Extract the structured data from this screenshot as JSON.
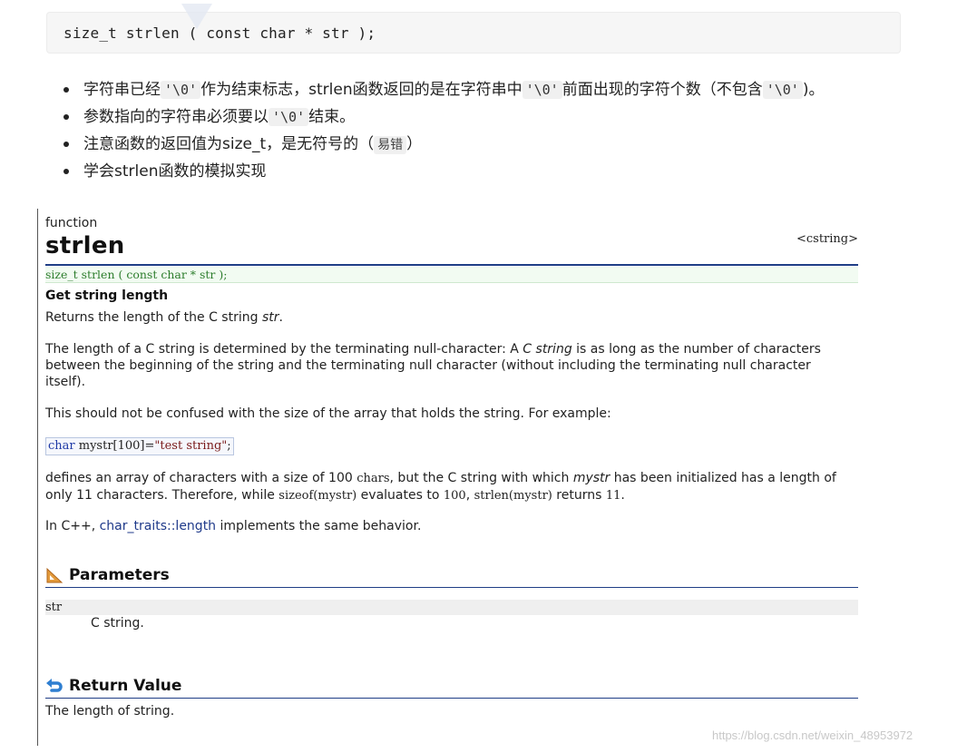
{
  "top": {
    "prototype": "size_t strlen ( const char * str );",
    "bullets": [
      {
        "a": "字符串已经",
        "b": "'\\0'",
        "c": "作为结束标志，strlen函数返回的是在字符串中",
        "d": "'\\0'",
        "e": "前面出现的字符个数（不包含",
        "f": "'\\0'",
        "g": ")。"
      },
      {
        "a": "参数指向的字符串必须要以",
        "b": "'\\0'",
        "c": "结束。"
      },
      {
        "a": "注意函数的返回值为size_t，是无符号的（",
        "b": "易错",
        "c": "）"
      },
      {
        "a": "学会strlen函数的模拟实现"
      }
    ]
  },
  "ref": {
    "kind": "function",
    "name": "strlen",
    "header": "<cstring>",
    "prototype": "size_t strlen ( const char * str );",
    "brief": "Get string length",
    "p1": {
      "text": "Returns the length of the C string ",
      "em": "str",
      "end": "."
    },
    "p2": {
      "a": "The length of a C string is determined by the terminating null-character: A ",
      "em": "C string",
      "b": " is as long as the number of characters between the beginning of the string and the terminating null character (without including the terminating null character itself)."
    },
    "p3": "This should not be confused with the size of the array that holds the string. For example:",
    "example": {
      "kw": "char",
      "mid": " mystr[100]=",
      "str": "\"test string\"",
      "end": ";"
    },
    "p4": {
      "a": "defines an array of characters with a size of 100 ",
      "m1": "chars",
      "b": ", but the C string with which ",
      "em": "mystr",
      "c": " has been initialized has a length of only 11 characters. Therefore, while ",
      "m2": "sizeof(mystr)",
      "d": " evaluates to ",
      "m3": "100",
      "e": ", ",
      "m4": "strlen(mystr)",
      "f": " returns ",
      "m5": "11",
      "g": "."
    },
    "p5": {
      "a": "In C++, ",
      "link": "char_traits::length",
      "b": " implements the same behavior."
    },
    "params_title": "Parameters",
    "param_name": "str",
    "param_desc": "C string.",
    "return_title": "Return Value",
    "return_desc": "The length of string."
  },
  "watermark": "https://blog.csdn.net/weixin_48953972",
  "colors": {
    "section_rule": "#1f3e86",
    "proto_green": "#2d7d2d",
    "link": "#1f3a8a"
  },
  "icons": {
    "params": "ruler-triangle-icon",
    "return": "return-arrow-icon"
  }
}
